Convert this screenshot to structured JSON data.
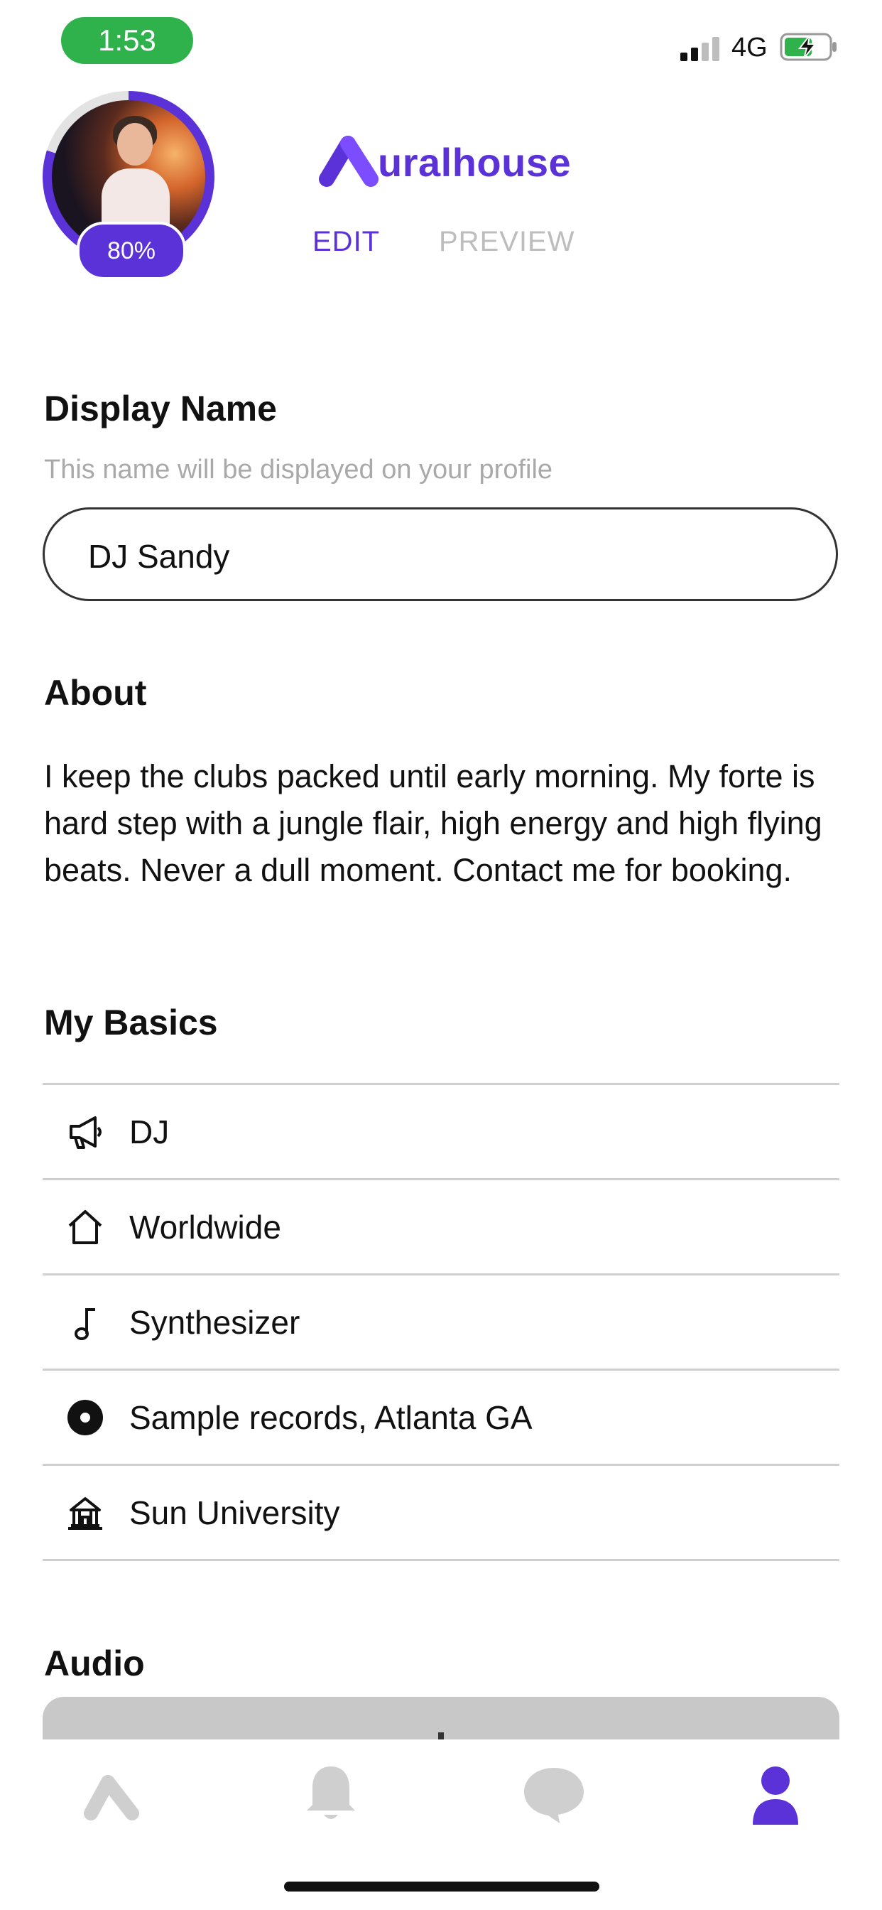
{
  "status_bar": {
    "time": "1:53",
    "network": "4G",
    "time_pill_color": "#2fb24c"
  },
  "profile": {
    "completion_label": "80%",
    "completion_fraction": 0.8
  },
  "brand": {
    "name": "uralhouse",
    "color": "#5a32d8"
  },
  "tabs": {
    "edit": "EDIT",
    "preview": "PREVIEW",
    "active": "edit"
  },
  "display_name": {
    "title": "Display Name",
    "hint": "This name will be displayed on your profile",
    "value": "DJ Sandy"
  },
  "about": {
    "title": "About",
    "text": "I keep the clubs packed until early morning. My forte is hard step with a jungle flair, high energy and high flying beats. Never a dull moment. Contact me for booking."
  },
  "basics": {
    "title": "My Basics",
    "items": [
      {
        "icon": "megaphone-icon",
        "label": "DJ"
      },
      {
        "icon": "home-icon",
        "label": "Worldwide"
      },
      {
        "icon": "music-note-icon",
        "label": "Synthesizer"
      },
      {
        "icon": "record-icon",
        "label": "Sample records, Atlanta GA"
      },
      {
        "icon": "university-icon",
        "label": "Sun University"
      }
    ]
  },
  "audio": {
    "title": "Audio"
  },
  "bottom_nav": {
    "items": [
      "brand-tab-icon",
      "bell-icon",
      "chat-bubble-icon",
      "profile-icon"
    ],
    "active": "profile-icon",
    "active_color": "#5a32d8",
    "inactive_color": "#cfcfcf"
  }
}
